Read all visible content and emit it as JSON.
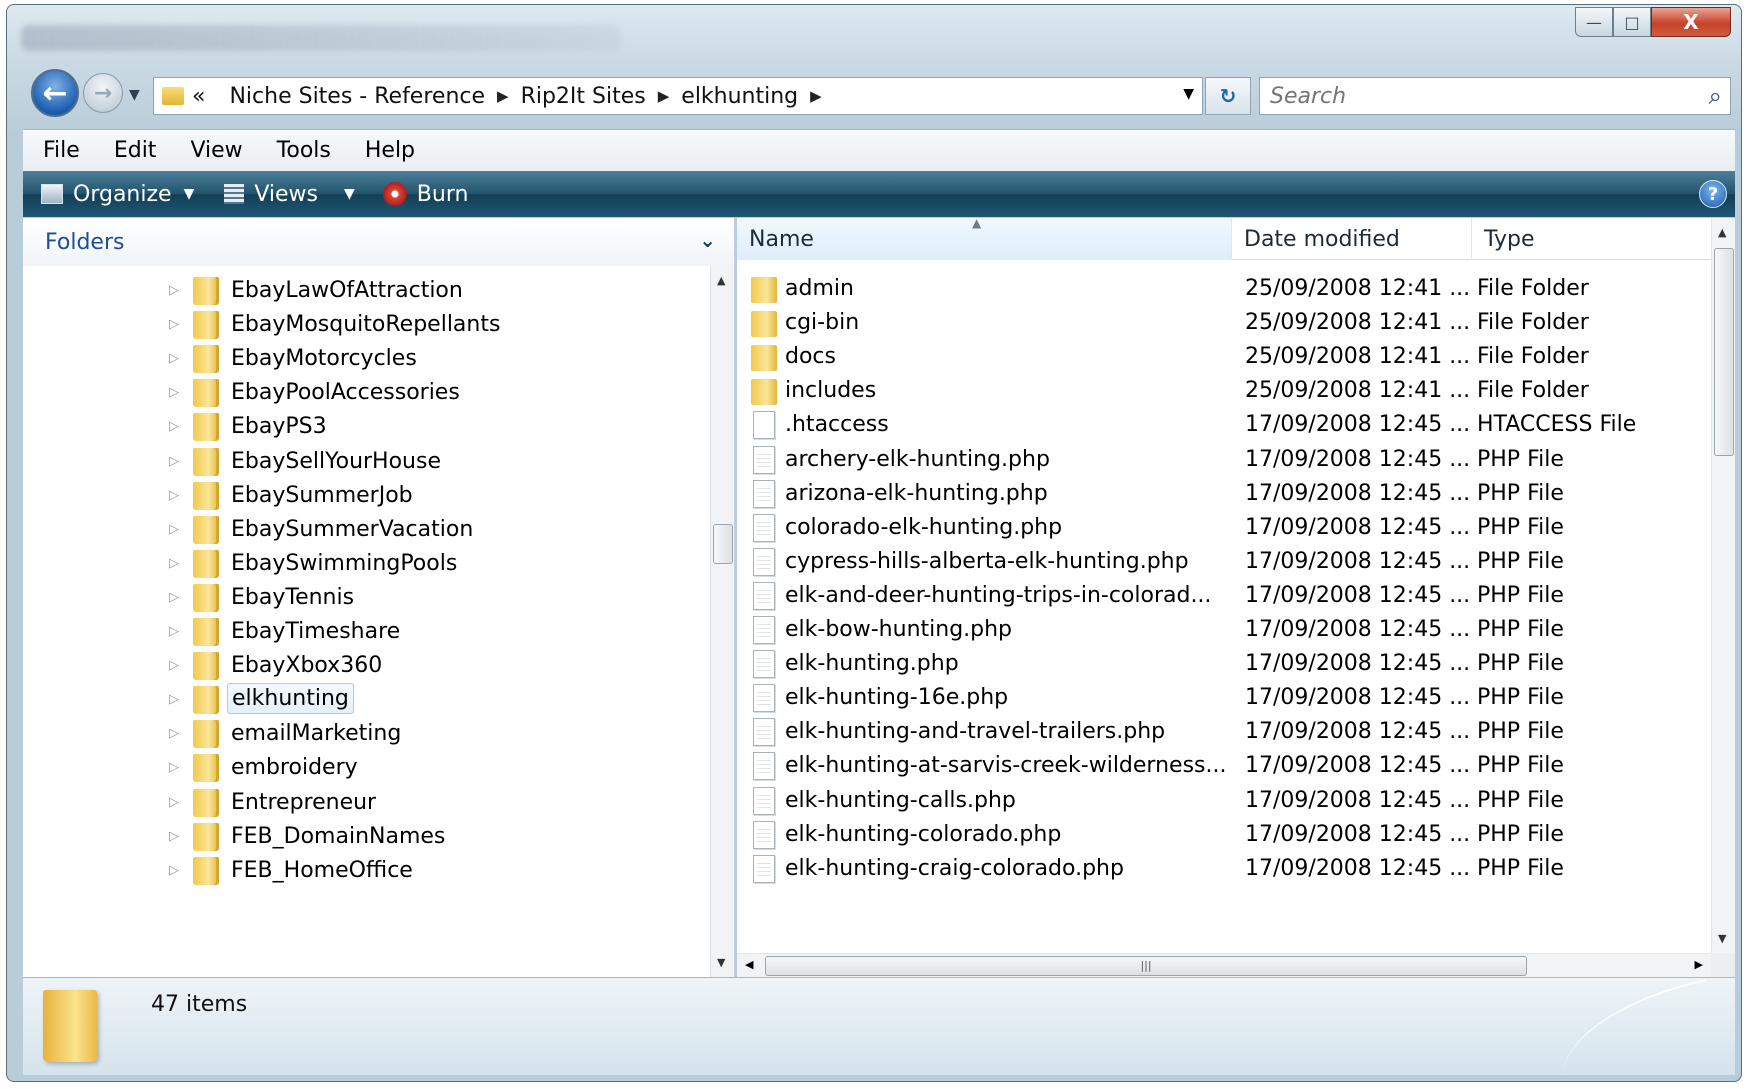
{
  "window": {
    "caption_buttons": {
      "minimize": "—",
      "maximize": "□",
      "close": "X"
    }
  },
  "nav": {
    "back_glyph": "←",
    "forward_glyph": "→",
    "breadcrumb_prefix": "«",
    "breadcrumb": [
      "Niche Sites - Reference",
      "Rip2It Sites",
      "elkhunting"
    ],
    "search_placeholder": "Search"
  },
  "menu": [
    "File",
    "Edit",
    "View",
    "Tools",
    "Help"
  ],
  "toolbar": {
    "organize_label": "Organize",
    "views_label": "Views",
    "burn_label": "Burn",
    "help_glyph": "?"
  },
  "folders_pane": {
    "header": "Folders",
    "items": [
      {
        "label": "EbayLawOfAttraction",
        "selected": false
      },
      {
        "label": "EbayMosquitoRepellants",
        "selected": false
      },
      {
        "label": "EbayMotorcycles",
        "selected": false
      },
      {
        "label": "EbayPoolAccessories",
        "selected": false
      },
      {
        "label": "EbayPS3",
        "selected": false
      },
      {
        "label": "EbaySellYourHouse",
        "selected": false
      },
      {
        "label": "EbaySummerJob",
        "selected": false
      },
      {
        "label": "EbaySummerVacation",
        "selected": false
      },
      {
        "label": "EbaySwimmingPools",
        "selected": false
      },
      {
        "label": "EbayTennis",
        "selected": false
      },
      {
        "label": "EbayTimeshare",
        "selected": false
      },
      {
        "label": "EbayXbox360",
        "selected": false
      },
      {
        "label": "elkhunting",
        "selected": true
      },
      {
        "label": "emailMarketing",
        "selected": false
      },
      {
        "label": "embroidery",
        "selected": false
      },
      {
        "label": "Entrepreneur",
        "selected": false
      },
      {
        "label": "FEB_DomainNames",
        "selected": false
      },
      {
        "label": "FEB_HomeOffice",
        "selected": false
      }
    ]
  },
  "files": {
    "columns": {
      "name": "Name",
      "date": "Date modified",
      "type": "Type"
    },
    "rows": [
      {
        "name": "admin",
        "date": "25/09/2008 12:41 ...",
        "type": "File Folder",
        "kind": "folder"
      },
      {
        "name": "cgi-bin",
        "date": "25/09/2008 12:41 ...",
        "type": "File Folder",
        "kind": "folder"
      },
      {
        "name": "docs",
        "date": "25/09/2008 12:41 ...",
        "type": "File Folder",
        "kind": "folder"
      },
      {
        "name": "includes",
        "date": "25/09/2008 12:41 ...",
        "type": "File Folder",
        "kind": "folder"
      },
      {
        "name": ".htaccess",
        "date": "17/09/2008 12:45 ...",
        "type": "HTACCESS File",
        "kind": "blank"
      },
      {
        "name": "archery-elk-hunting.php",
        "date": "17/09/2008 12:45 ...",
        "type": "PHP File",
        "kind": "php"
      },
      {
        "name": "arizona-elk-hunting.php",
        "date": "17/09/2008 12:45 ...",
        "type": "PHP File",
        "kind": "php"
      },
      {
        "name": "colorado-elk-hunting.php",
        "date": "17/09/2008 12:45 ...",
        "type": "PHP File",
        "kind": "php"
      },
      {
        "name": "cypress-hills-alberta-elk-hunting.php",
        "date": "17/09/2008 12:45 ...",
        "type": "PHP File",
        "kind": "php"
      },
      {
        "name": "elk-and-deer-hunting-trips-in-colorad...",
        "date": "17/09/2008 12:45 ...",
        "type": "PHP File",
        "kind": "php"
      },
      {
        "name": "elk-bow-hunting.php",
        "date": "17/09/2008 12:45 ...",
        "type": "PHP File",
        "kind": "php"
      },
      {
        "name": "elk-hunting.php",
        "date": "17/09/2008 12:45 ...",
        "type": "PHP File",
        "kind": "php"
      },
      {
        "name": "elk-hunting-16e.php",
        "date": "17/09/2008 12:45 ...",
        "type": "PHP File",
        "kind": "php"
      },
      {
        "name": "elk-hunting-and-travel-trailers.php",
        "date": "17/09/2008 12:45 ...",
        "type": "PHP File",
        "kind": "php"
      },
      {
        "name": "elk-hunting-at-sarvis-creek-wilderness....",
        "date": "17/09/2008 12:45 ...",
        "type": "PHP File",
        "kind": "php"
      },
      {
        "name": "elk-hunting-calls.php",
        "date": "17/09/2008 12:45 ...",
        "type": "PHP File",
        "kind": "php"
      },
      {
        "name": "elk-hunting-colorado.php",
        "date": "17/09/2008 12:45 ...",
        "type": "PHP File",
        "kind": "php"
      },
      {
        "name": "elk-hunting-craig-colorado.php",
        "date": "17/09/2008 12:45 ...",
        "type": "PHP File",
        "kind": "php"
      }
    ]
  },
  "status": {
    "item_count": "47 items"
  },
  "colors": {
    "command_bar": "#1f5775",
    "selection_border": "#9fd0f2",
    "folders_header_text": "#1e4f96",
    "close_button": "#c6422b"
  }
}
